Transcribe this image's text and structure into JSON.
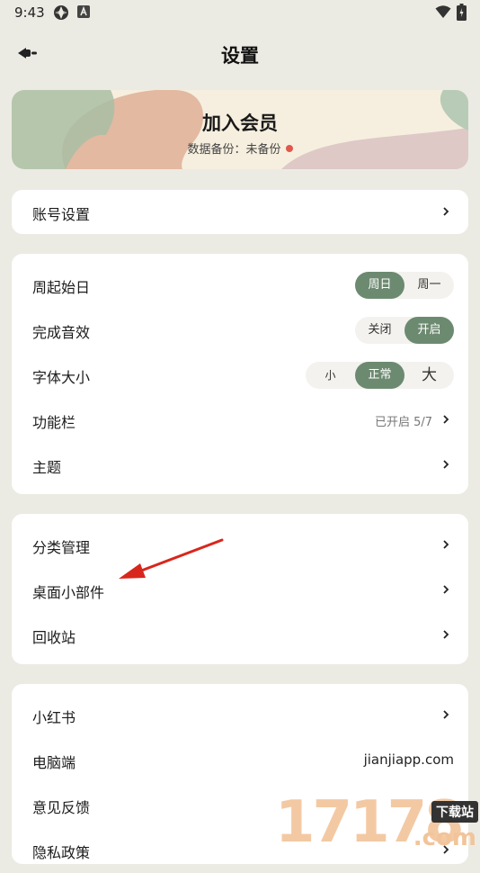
{
  "status": {
    "time": "9:43"
  },
  "header": {
    "title": "设置"
  },
  "member": {
    "title": "加入会员",
    "subtitle": "数据备份：未备份"
  },
  "account": {
    "label": "账号设置"
  },
  "prefs": {
    "week_start": {
      "label": "周起始日",
      "options": [
        "周日",
        "周一"
      ],
      "selected": "周日"
    },
    "sound": {
      "label": "完成音效",
      "options": [
        "关闭",
        "开启"
      ],
      "selected": "开启"
    },
    "font_size": {
      "label": "字体大小",
      "options": [
        "小",
        "正常",
        "大"
      ],
      "selected": "正常"
    },
    "toolbar": {
      "label": "功能栏",
      "value": "已开启 5/7"
    },
    "theme": {
      "label": "主题"
    }
  },
  "manage": {
    "category": {
      "label": "分类管理"
    },
    "widget": {
      "label": "桌面小部件"
    },
    "trash": {
      "label": "回收站"
    }
  },
  "more": {
    "xiaohongshu": {
      "label": "小红书"
    },
    "desktop": {
      "label": "电脑端",
      "value": "jianjiapp.com"
    },
    "feedback": {
      "label": "意见反馈"
    },
    "privacy": {
      "label": "隐私政策"
    }
  },
  "watermark": {
    "digits": "17178",
    "badge": "下载站",
    "suffix": ".com"
  },
  "colors": {
    "accent": "#6c8a70",
    "background": "#ecebe3",
    "arrow": "#d9261c",
    "dot": "#e2574c"
  }
}
